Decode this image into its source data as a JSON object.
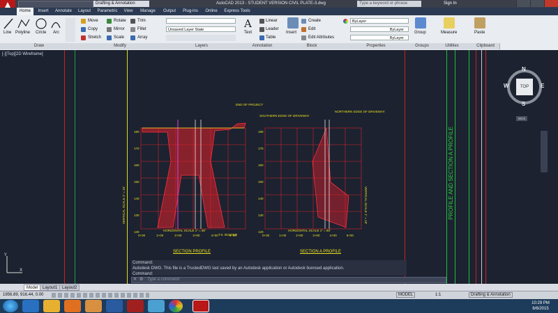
{
  "titlebar": {
    "title": "AutoCAD 2013 - STUDENT VERSION   CIVIL PLATE-3.dwg",
    "workspace": "Drafting & Annotation",
    "search_placeholder": "Type a keyword or phrase",
    "sign_in": "Sign In"
  },
  "tabs": [
    "Home",
    "Insert",
    "Annotate",
    "Layout",
    "Parametric",
    "View",
    "Manage",
    "Output",
    "Plug-ins",
    "Online",
    "Express Tools"
  ],
  "ribbon": {
    "draw": {
      "title": "Draw",
      "line": "Line",
      "polyline": "Polyline",
      "circle": "Circle",
      "arc": "Arc"
    },
    "modify": {
      "title": "Modify",
      "move": "Move",
      "rotate": "Rotate",
      "trim": "Trim",
      "copy": "Copy",
      "mirror": "Mirror",
      "fillet": "Fillet",
      "stretch": "Stretch",
      "scale": "Scale",
      "array": "Array"
    },
    "layers": {
      "title": "Layers",
      "state": "Unsaved Layer State"
    },
    "annotation": {
      "title": "Annotation",
      "text": "Text",
      "linear": "Linear",
      "leader": "Leader",
      "table": "Table"
    },
    "block": {
      "title": "Block",
      "insert": "Insert",
      "create": "Create",
      "edit": "Edit",
      "edit_attributes": "Edit Attributes"
    },
    "properties": {
      "title": "Properties",
      "color": "ByLayer",
      "linetype": "ByLayer",
      "lineweight": "ByLayer"
    },
    "groups": {
      "title": "Groups",
      "group": "Group"
    },
    "utilities": {
      "title": "Utilities",
      "measure": "Measure"
    },
    "clipboard": {
      "title": "Clipboard",
      "paste": "Paste"
    }
  },
  "viewport": {
    "label": "[-][Top][2D Wireframe]",
    "compass": {
      "n": "N",
      "s": "S",
      "e": "E",
      "w": "W",
      "top": "TOP",
      "wcs": "WCS"
    }
  },
  "drawing": {
    "profile1_title": "SECTION  PROFILE",
    "profile2_title": "SECTION  A  PROFILE",
    "horiz_scale_1": "HORIZONTAL  SCALE  1\" = 80'",
    "horiz_scale_2": "HORIZONTAL  SCALE  1\" = 80'",
    "vert_scale_1": "VERTICAL SCALE 1\" = 10'",
    "vert_scale_2": "VERTICAL SCALE 1\" = 10'",
    "elev_1": [
      "180",
      "170",
      "160",
      "150",
      "140",
      "130",
      "120"
    ],
    "elev_2": [
      "180",
      "170",
      "160",
      "150",
      "140",
      "130",
      "120"
    ],
    "sta_1": [
      "0+00",
      "1+00",
      "2+00",
      "3+00",
      "4+00",
      "5+00"
    ],
    "sta_2": [
      "0+00",
      "1+00",
      "2+00",
      "3+00",
      "4+00",
      "5+00"
    ],
    "callout_1": "SOUTHERN EDGE OF DRIVEWAY",
    "callout_2": "NORTHERN EDGE OF DRIVEWAY",
    "callout_3": "END OF PROJECT",
    "callout_4": "T.S.  BUSTER",
    "side_title": "PROFILE AND SECTION A PROFILE"
  },
  "command": {
    "line1": "Command:",
    "line2": "Autodesk DWG.  This file is a TrustedDWG last saved by an Autodesk application or Autodesk licensed application.",
    "line3": "Command:",
    "prompt_placeholder": "Type a command"
  },
  "layout_tabs": [
    "Model",
    "Layout1",
    "Layout2"
  ],
  "status": {
    "coords": "1956.89, 916.44, 0.00",
    "model": "MODEL",
    "scale": "1:1",
    "workspace": "Drafting & Annotation"
  },
  "taskbar": {
    "time": "10:29 PM",
    "date": "6/6/2015"
  },
  "colors": {
    "accent": "#b81818",
    "grid": "#e0202a",
    "hatch": "#e0202a",
    "annot": "#e8e020",
    "border_green": "#2ecc40"
  }
}
